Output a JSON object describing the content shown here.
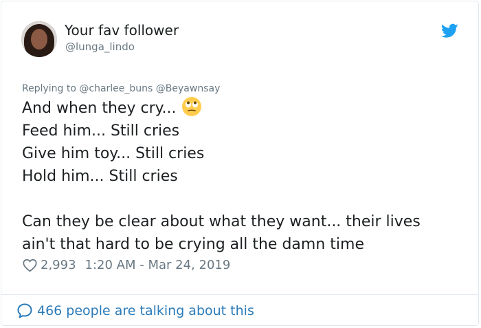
{
  "user": {
    "name": "Your fav follower",
    "handle": "@lunga_lindo"
  },
  "reply": {
    "prefix": "Replying to",
    "mentions": "@charlee_buns @Beyawnsay"
  },
  "tweet": {
    "lines": [
      "And when they cry...",
      "Feed him... Still cries",
      "Give him toy... Still cries",
      "Hold him... Still cries",
      "",
      "Can they be clear about what they want... their lives",
      "ain't that hard to be crying all the damn time"
    ],
    "emoji": "face-with-rolling-eyes"
  },
  "meta": {
    "likes": "2,993",
    "timestamp": "1:20 AM - Mar 24, 2019"
  },
  "footer": {
    "talking": "466 people are talking about this"
  },
  "colors": {
    "brand_blue": "#1da1f2",
    "link_blue": "#2b7bb9",
    "muted": "#697882",
    "text": "#1c2022",
    "border": "#e1e8ed"
  },
  "icons": [
    "twitter-bird-icon",
    "heart-icon",
    "speech-bubble-icon",
    "rolling-eyes-emoji"
  ]
}
